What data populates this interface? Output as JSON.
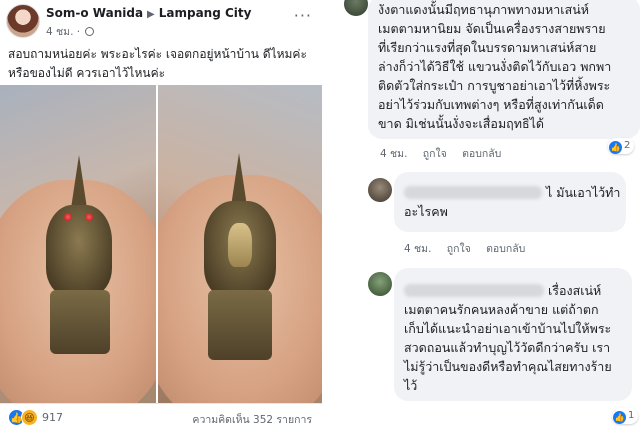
{
  "post": {
    "author": "Som-o Wanida",
    "separator": "▶",
    "group": "Lampang City",
    "time": "4 ชม.",
    "more": "···",
    "text_line1": "สอบถามหน่อยค่ะ พระอะไรค่ะ เจอตกอยู่หน้าบ้าน ดีไหมค่ะ",
    "text_line2": "หรือของไม่ดี ควรเอาไว้ไหนค่ะ",
    "reaction_like_icon": "👍",
    "reaction_haha_icon": "😆",
    "reaction_count": "917",
    "comment_count": "ความคิดเห็น 352 รายการ"
  },
  "comments": [
    {
      "lines": [
        "งังตาแดงนั้นมีฤทธานุภาพทางมหาเสน่ห์",
        "เมตตามหานิยม จัดเป็นเครื่องรางสายพราย",
        "ที่เรียกว่าแรงที่สุดในบรรดามหาเสน่ห์สาย",
        "ล่างก็ว่าได้วิธีใช้ แขวนงั่งติดไว้กับเอว พกพา",
        "ติดตัวใส่กระเป๋า การบูชาอย่าเอาไว้ที่หิ้งพระ",
        "อย่าไว้ร่วมกับเทพต่างๆ หรือที่สูงเท่ากันเด็ด",
        "ขาด มิเช่นนั้นงั่งจะเสื่อมฤทธิได้"
      ],
      "time": "4 ชม.",
      "like": "ถูกใจ",
      "reply": "ตอบกลับ",
      "reaction_icon": "👍",
      "reaction_count": "2"
    },
    {
      "line1_visible": "ไ มันเอาไว้ทำ",
      "line2": "อะไรคพ",
      "time": "4 ชม.",
      "like": "ถูกใจ",
      "reply": "ตอบกลับ"
    },
    {
      "line1_visible": "เรื่องสเน่ห์",
      "lines": [
        "เมตตาคนรักคนหลงค้าขาย แต่ถ้าตก",
        "เก็บได้แนะนำอย่าเอาเข้าบ้านไปให้พระ",
        "สวดถอนแล้วทำบุญไว้วัดดีกว่าครับ เรา",
        "ไม่รู้ว่าเป็นของดีหรือทำคุณไสยทางร้าย",
        "ไว้"
      ],
      "reaction_icon": "👍",
      "reaction_count": "1"
    }
  ],
  "colors": {
    "accent": "#1877f2",
    "bubble": "#f0f2f5",
    "muted": "#606770"
  }
}
